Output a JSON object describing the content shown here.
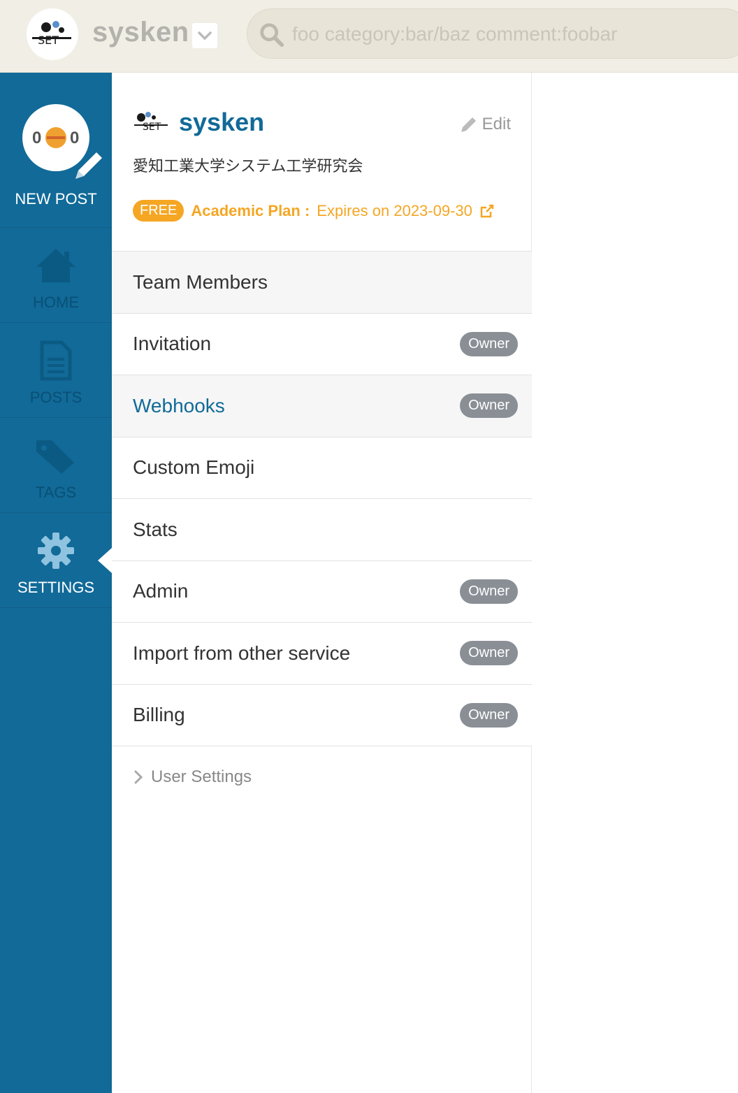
{
  "header": {
    "team_name": "sysken",
    "search_placeholder": "foo category:bar/baz comment:foobar",
    "logo_text": "SET"
  },
  "sidebar": {
    "new_post_label": "NEW POST",
    "avatar_text_left": "0",
    "avatar_text_right": "0",
    "items": [
      {
        "label": "HOME",
        "icon": "home-icon"
      },
      {
        "label": "POSTS",
        "icon": "document-icon"
      },
      {
        "label": "TAGS",
        "icon": "tag-icon"
      },
      {
        "label": "SETTINGS",
        "icon": "gear-icon",
        "active": true
      }
    ]
  },
  "team": {
    "logo_text": "SET",
    "name": "sysken",
    "edit_label": "Edit",
    "description": "愛知工業大学システム工学研究会",
    "plan_badge": "FREE",
    "plan_name": "Academic Plan :",
    "plan_expiry": "Expires on 2023-09-30"
  },
  "menu": {
    "items": [
      {
        "label": "Team Members"
      },
      {
        "label": "Invitation",
        "badge": "Owner"
      },
      {
        "label": "Webhooks",
        "badge": "Owner"
      },
      {
        "label": "Custom Emoji"
      },
      {
        "label": "Stats"
      },
      {
        "label": "Admin",
        "badge": "Owner"
      },
      {
        "label": "Import from other service",
        "badge": "Owner"
      },
      {
        "label": "Billing",
        "badge": "Owner"
      }
    ],
    "user_settings_label": "User Settings"
  },
  "colors": {
    "sidebar": "#116a98",
    "accent": "#116a98",
    "plan": "#f5a623",
    "badge": "#8a8f96"
  }
}
